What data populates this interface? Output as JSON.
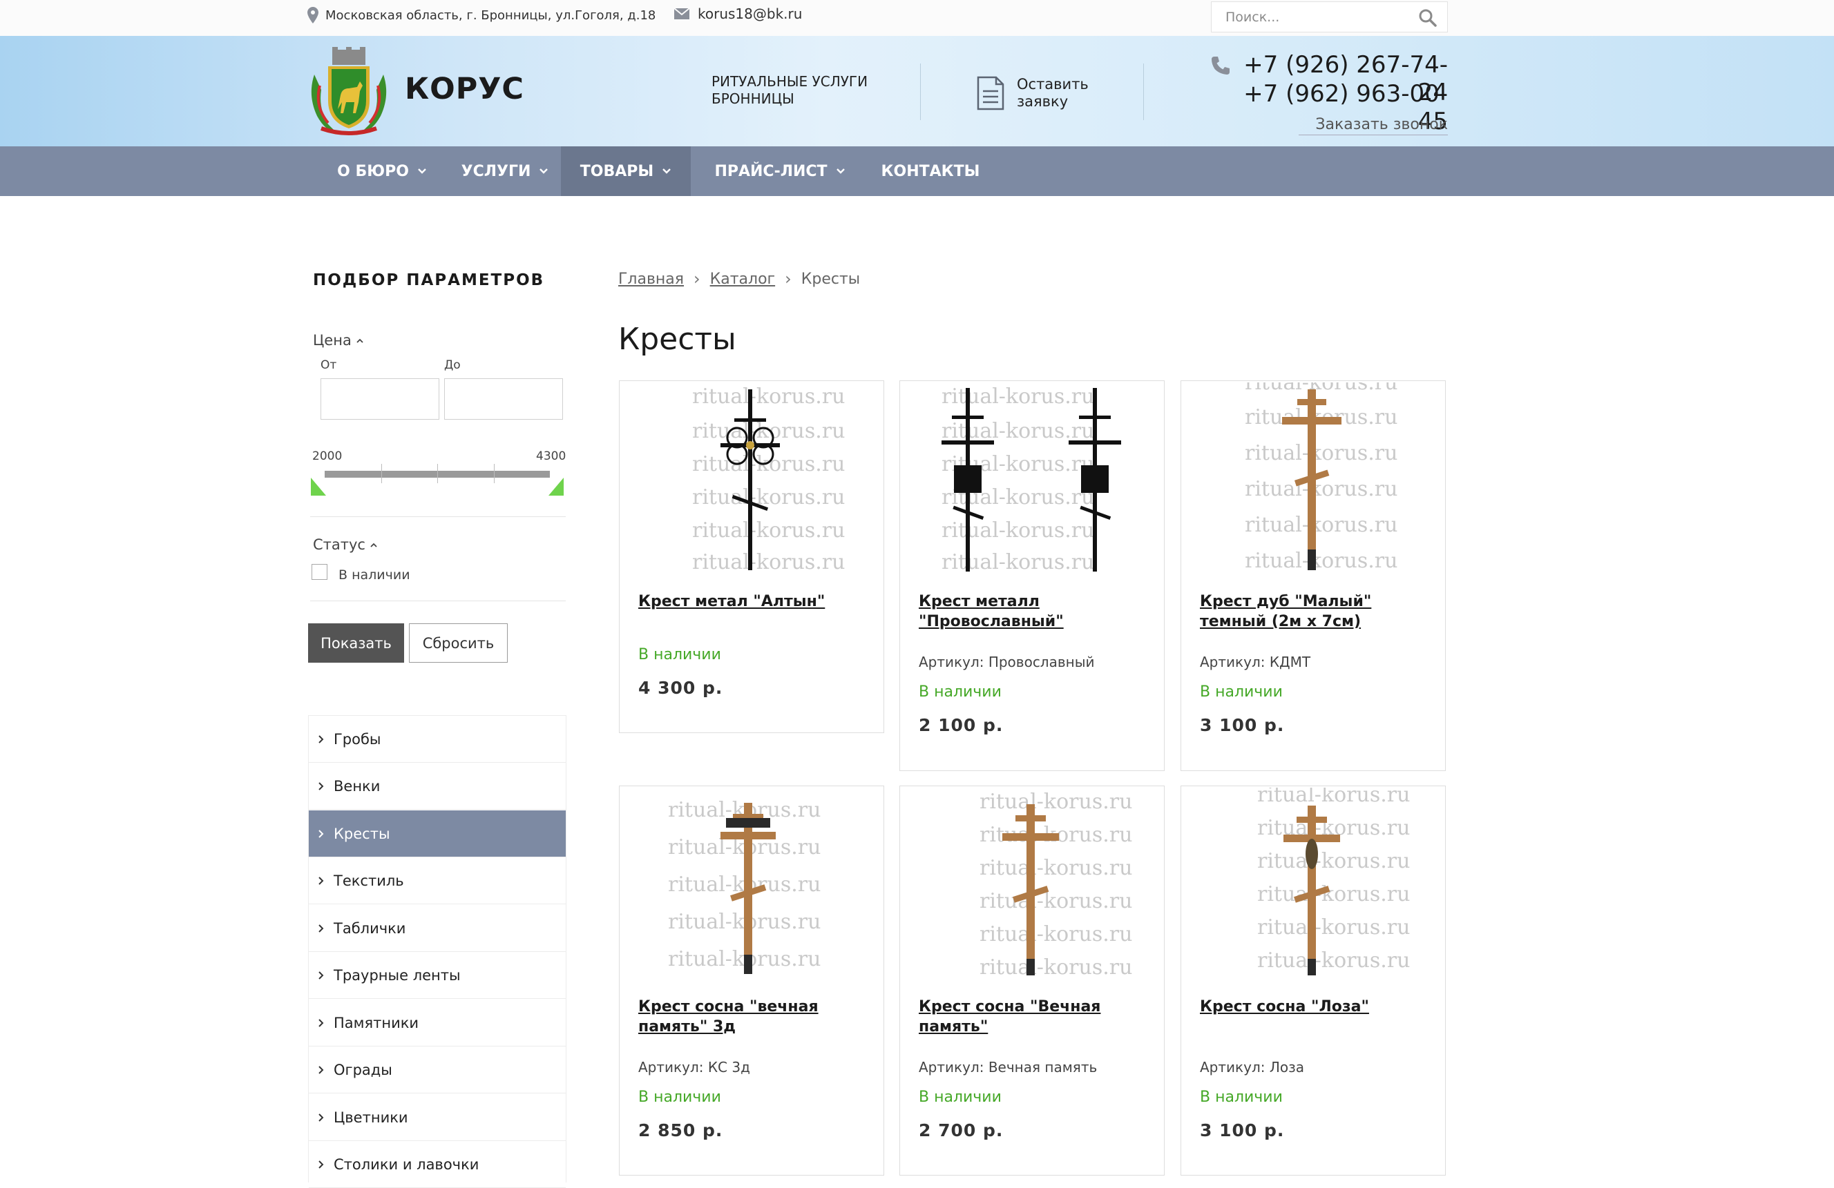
{
  "topbar": {
    "address": "Московская область, г. Бронницы, ул.Гоголя, д.18",
    "email": "korus18@bk.ru",
    "search_placeholder": "Поиск..."
  },
  "header": {
    "logo_text": "КОРУС",
    "tagline": "РИТУАЛЬНЫЕ УСЛУГИ БРОННИЦЫ",
    "request_label": "Оставить заявку",
    "phone1": "+7 (926) 267-74-24",
    "phone2": "+7 (962) 963-00-45",
    "callback_label": "Заказать звонок"
  },
  "nav": {
    "items": [
      {
        "label": "О БЮРО"
      },
      {
        "label": "УСЛУГИ"
      },
      {
        "label": "ТОВАРЫ"
      },
      {
        "label": "ПРАЙС-ЛИСТ"
      },
      {
        "label": "КОНТАКТЫ"
      }
    ]
  },
  "filter": {
    "title": "ПОДБОР ПАРАМЕТРОВ",
    "price_label": "Цена",
    "from_label": "От",
    "to_label": "До",
    "slider_min": "2000",
    "slider_max": "4300",
    "status_label": "Статус",
    "in_stock_label": "В наличии",
    "show_button": "Показать",
    "reset_button": "Сбросить"
  },
  "categories": {
    "items": [
      {
        "label": "Гробы"
      },
      {
        "label": "Венки"
      },
      {
        "label": "Кресты"
      },
      {
        "label": "Текстиль"
      },
      {
        "label": "Таблички"
      },
      {
        "label": "Траурные ленты"
      },
      {
        "label": "Памятники"
      },
      {
        "label": "Ограды"
      },
      {
        "label": "Цветники"
      },
      {
        "label": "Столики и лавочки"
      }
    ]
  },
  "breadcrumb": {
    "home": "Главная",
    "catalog": "Каталог",
    "current": "Кресты"
  },
  "page_title": "Кресты",
  "watermark": "ritual-korus.ru",
  "products": {
    "items": [
      {
        "name": "Крест метал \"Алтын\"",
        "article": "",
        "stock": "В наличии",
        "price": "4 300 р."
      },
      {
        "name": "Крест металл \"Провославный\"",
        "article": "Артикул: Провославный",
        "stock": "В наличии",
        "price": "2 100 р."
      },
      {
        "name": "Крест дуб \"Малый\" темный (2м х 7см)",
        "article": "Артикул: КДМТ",
        "stock": "В наличии",
        "price": "3 100 р."
      },
      {
        "name": "Крест сосна \"вечная память\" 3д",
        "article": "Артикул: КС 3д",
        "stock": "В наличии",
        "price": "2 850 р."
      },
      {
        "name": "Крест сосна \"Вечная память\"",
        "article": "Артикул: Вечная память",
        "stock": "В наличии",
        "price": "2 700 р."
      },
      {
        "name": "Крест сосна \"Лоза\"",
        "article": "Артикул: Лоза",
        "stock": "В наличии",
        "price": "3 100 р."
      }
    ]
  },
  "colors": {
    "nav_bg": "#7d8aa3",
    "in_stock": "#45a827",
    "slider_handle": "#6fd34c"
  },
  "icons": [
    "map-pin-icon",
    "mail-icon",
    "search-icon",
    "document-icon",
    "phone-icon",
    "chevron-down-icon",
    "chevron-up-icon",
    "chevron-right-icon"
  ]
}
